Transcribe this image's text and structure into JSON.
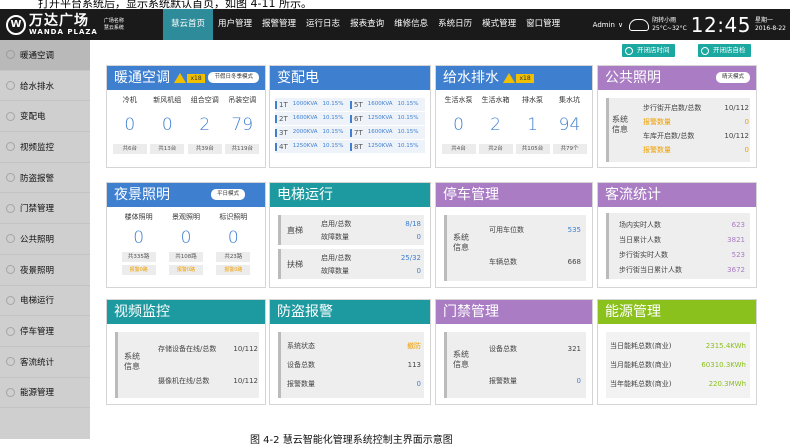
{
  "top_cut_text": "打开平台系统后，显示系统默认首页，如图 4-11 所示。",
  "header": {
    "logo_cn": "万达广场",
    "logo_en": "WANDA PLAZA",
    "logo_sub1": "广场名称",
    "logo_sub2": "慧云系统",
    "nav": [
      "慧云首页",
      "用户管理",
      "报警管理",
      "运行日志",
      "报表查询",
      "维修信息",
      "系统日历",
      "模式管理",
      "窗口管理"
    ],
    "admin": "Admin",
    "weather_line1": "阴转小雨",
    "weather_line2": "25°C~32°C",
    "clock": "12:45",
    "day": "星期一",
    "date": "2016-8-22"
  },
  "sidebar": [
    "暖通空调",
    "给水排水",
    "变配电",
    "视频监控",
    "防盗报警",
    "门禁管理",
    "公共照明",
    "夜景照明",
    "电梯运行",
    "停车管理",
    "客流统计",
    "能源管理"
  ],
  "ops": {
    "btn1": "开闭店时间",
    "btn2": "开闭店自检"
  },
  "hvac": {
    "title": "暖通空调",
    "badge": "x18",
    "season": "节假日冬季模式",
    "cols": [
      {
        "label": "冷机",
        "num": "0",
        "foot": "共6台"
      },
      {
        "label": "新风机组",
        "num": "0",
        "foot": "共13台"
      },
      {
        "label": "组合空调",
        "num": "2",
        "foot": "共39台"
      },
      {
        "label": "吊装空调",
        "num": "79",
        "foot": "共119台"
      }
    ]
  },
  "power": {
    "title": "变配电",
    "rows": [
      [
        "1T",
        "1000KVA",
        "10.15%",
        "5T",
        "1600KVA",
        "10.15%"
      ],
      [
        "2T",
        "1600KVA",
        "10.15%",
        "6T",
        "1250KVA",
        "10.15%"
      ],
      [
        "3T",
        "2000KVA",
        "10.15%",
        "7T",
        "1600KVA",
        "10.15%"
      ],
      [
        "4T",
        "1250KVA",
        "10.15%",
        "8T",
        "1250KVA",
        "10.15%"
      ]
    ]
  },
  "water": {
    "title": "给水排水",
    "badge": "x18",
    "cols": [
      {
        "label": "生活水泵",
        "num": "0",
        "foot": "共4台"
      },
      {
        "label": "生活水箱",
        "num": "2",
        "foot": "共2台"
      },
      {
        "label": "排水泵",
        "num": "1",
        "foot": "共105台"
      },
      {
        "label": "集水坑",
        "num": "94",
        "foot": "共79个"
      }
    ]
  },
  "lighting": {
    "title": "公共照明",
    "mode": "晴天模式",
    "sys": "系统\n信息",
    "rows": [
      {
        "k": "步行街开启数/总数",
        "v": "10/112",
        "c": "n"
      },
      {
        "k": "报警数量",
        "v": "0",
        "c": "o"
      },
      {
        "k": "车库开启数/总数",
        "v": "10/112",
        "c": "n"
      },
      {
        "k": "报警数量",
        "v": "0",
        "c": "o"
      }
    ]
  },
  "night": {
    "title": "夜景照明",
    "mode": "平日模式",
    "cols": [
      {
        "label": "楼体照明",
        "num": "0",
        "foot": "共335路",
        "alarm": "报警0路"
      },
      {
        "label": "景观照明",
        "num": "0",
        "foot": "共108路",
        "alarm": "报警0路"
      },
      {
        "label": "标识照明",
        "num": "0",
        "foot": "共23路",
        "alarm": "报警0路"
      }
    ]
  },
  "elevator": {
    "title": "电梯运行",
    "groups": [
      {
        "name": "直梯",
        "rows": [
          {
            "k": "启用/总数",
            "v": "8/18"
          },
          {
            "k": "故障数量",
            "v": "0"
          }
        ]
      },
      {
        "name": "扶梯",
        "rows": [
          {
            "k": "启用/总数",
            "v": "25/32"
          },
          {
            "k": "故障数量",
            "v": "0"
          }
        ]
      }
    ]
  },
  "parking": {
    "title": "停车管理",
    "sys": "系统\n信息",
    "rows": [
      {
        "k": "可用车位数",
        "v": "535",
        "c": "v"
      },
      {
        "k": "车辆总数",
        "v": "668",
        "c": "n"
      }
    ]
  },
  "traffic": {
    "title": "客流统计",
    "rows": [
      {
        "k": "场内实时人数",
        "v": "623"
      },
      {
        "k": "当日累计人数",
        "v": "3821"
      },
      {
        "k": "步行街实时人数",
        "v": "523"
      },
      {
        "k": "步行街当日累计人数",
        "v": "3672"
      }
    ]
  },
  "video": {
    "title": "视频监控",
    "sys": "系统\n信息",
    "rows": [
      {
        "k": "存储设备在线/总数",
        "v": "10/112"
      },
      {
        "k": "摄像机在线/总数",
        "v": "10/112"
      }
    ]
  },
  "alarm": {
    "title": "防盗报警",
    "rows": [
      {
        "k": "系统状态",
        "v": "撤防",
        "c": "o"
      },
      {
        "k": "设备总数",
        "v": "113",
        "c": "n"
      },
      {
        "k": "报警数量",
        "v": "0",
        "c": "v"
      }
    ]
  },
  "access": {
    "title": "门禁管理",
    "sys": "系统\n信息",
    "rows": [
      {
        "k": "设备总数",
        "v": "321",
        "c": "n"
      },
      {
        "k": "报警数量",
        "v": "0",
        "c": "v"
      }
    ]
  },
  "energy": {
    "title": "能源管理",
    "rows": [
      {
        "k": "当日能耗总数(商业)",
        "v": "2315.4KWh"
      },
      {
        "k": "当月能耗总数(商业)",
        "v": "60310.3KWh"
      },
      {
        "k": "当年能耗总数(商业)",
        "v": "220.3MWh"
      }
    ]
  },
  "caption": "图 4-2 慧云智能化管理系统控制主界面示意图"
}
